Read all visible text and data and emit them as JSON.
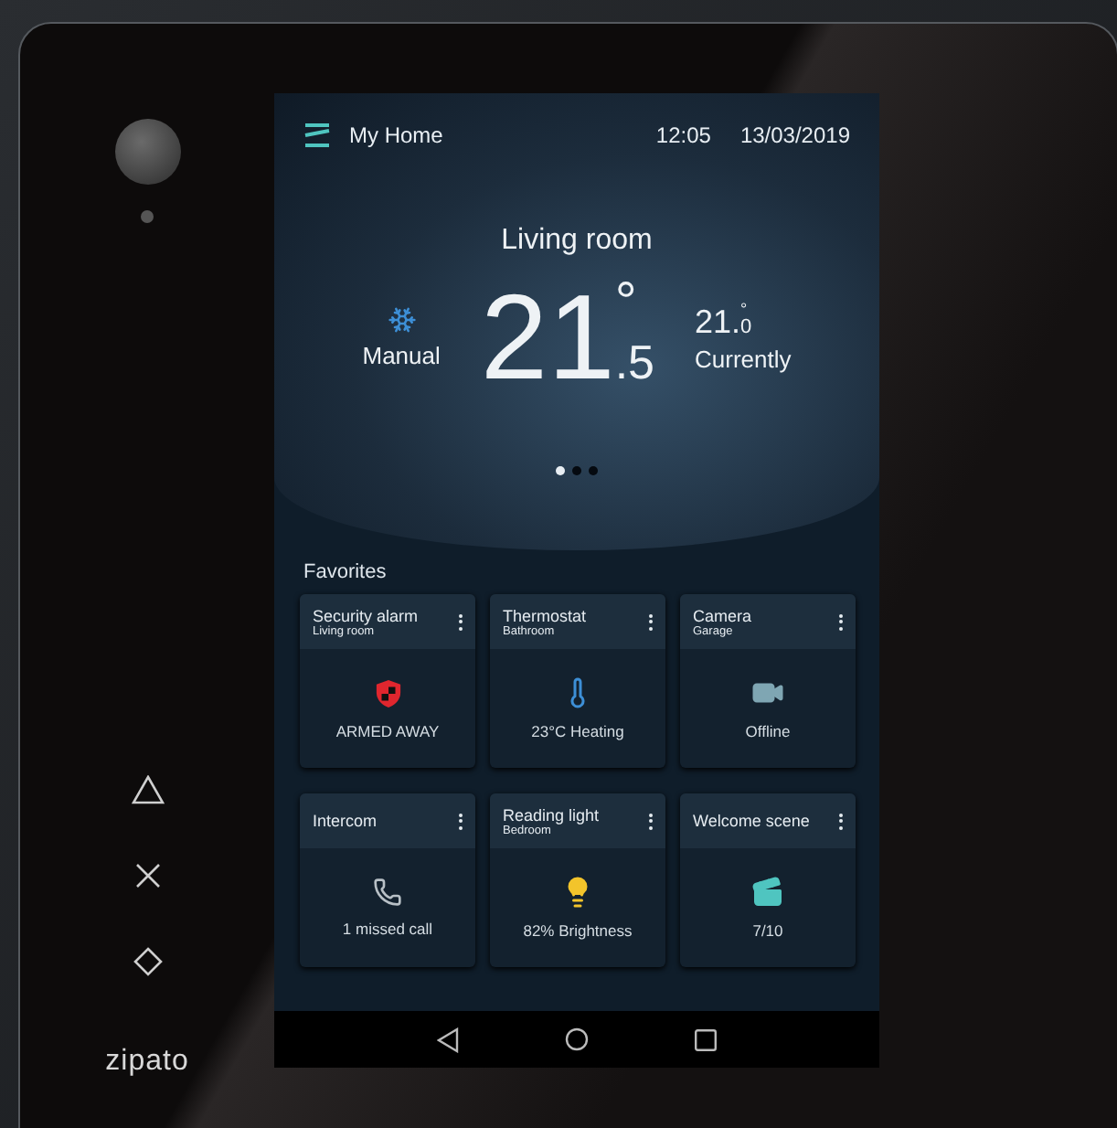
{
  "device": {
    "brand": "zipato"
  },
  "header": {
    "title": "My Home",
    "time": "12:05",
    "date": "13/03/2019"
  },
  "thermostat": {
    "room": "Living room",
    "mode": "Manual",
    "setpoint_whole": "21",
    "setpoint_fraction": ".5",
    "setpoint_degree": "°",
    "current_whole": "21.",
    "current_fraction": "0",
    "current_degree": "°",
    "current_label": "Currently"
  },
  "pages": [
    {
      "selected": true
    },
    {
      "selected": false
    },
    {
      "selected": false
    }
  ],
  "favorites": {
    "title": "Favorites",
    "tiles": [
      {
        "kind": "alarm",
        "title": "Security alarm",
        "subtitle": "Living room",
        "status": "ARMED AWAY"
      },
      {
        "kind": "thermostat",
        "title": "Thermostat",
        "subtitle": "Bathroom",
        "status": "23°C Heating"
      },
      {
        "kind": "camera",
        "title": "Camera",
        "subtitle": "Garage",
        "status": "Offline"
      },
      {
        "kind": "intercom",
        "title": "Intercom",
        "status": "1 missed call"
      },
      {
        "kind": "light",
        "title": "Reading light",
        "subtitle": "Bedroom",
        "status": "82% Brightness"
      },
      {
        "kind": "scene",
        "title": "Welcome scene",
        "status": "7/10"
      }
    ]
  }
}
